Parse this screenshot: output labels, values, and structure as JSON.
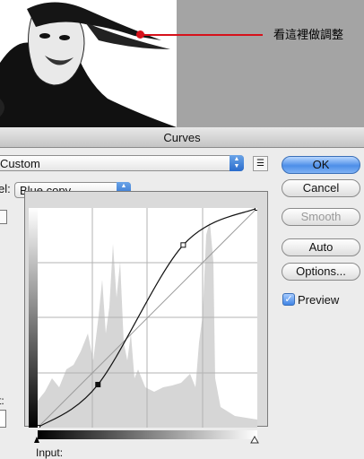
{
  "annotation": {
    "text": "看這裡做調整",
    "color": "#d6111b"
  },
  "dialog": {
    "title": "Curves",
    "preset": {
      "value": "Custom"
    },
    "channel": {
      "label": "el:",
      "value": "Blue copy"
    },
    "buttons": {
      "ok": "OK",
      "cancel": "Cancel",
      "smooth": "Smooth",
      "auto": "Auto",
      "options": "Options..."
    },
    "preview": {
      "label": "Preview",
      "checked": true
    },
    "left_partial_label": "t:",
    "input_label": "Input:"
  },
  "curve": {
    "control_points": [
      [
        0,
        0
      ],
      [
        70,
        50
      ],
      [
        169,
        212
      ],
      [
        255,
        255
      ]
    ],
    "accent_color": "#3a7ee0"
  }
}
